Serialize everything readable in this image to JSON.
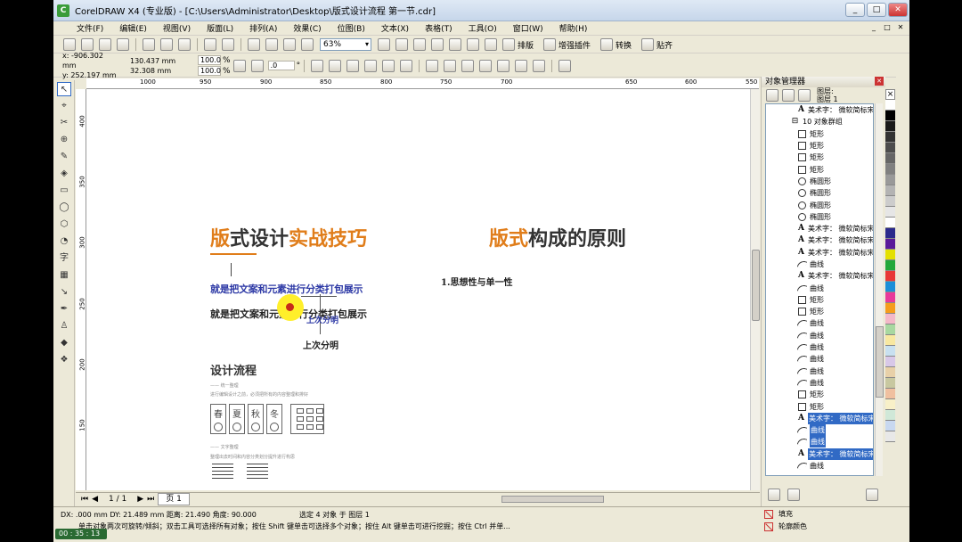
{
  "window": {
    "title": "CorelDRAW X4 (专业版) - [C:\\Users\\Administrator\\Desktop\\版式设计流程 第一节.cdr]",
    "app_icon_text": "C",
    "minimize": "_",
    "maximize": "□",
    "close": "✕"
  },
  "menu": [
    "文件(F)",
    "编辑(E)",
    "视图(V)",
    "版面(L)",
    "排列(A)",
    "效果(C)",
    "位图(B)",
    "文本(X)",
    "表格(T)",
    "工具(O)",
    "窗口(W)",
    "帮助(H)"
  ],
  "toolbar": {
    "zoom": "63%",
    "typeset": "排版",
    "plugin": "增强插件",
    "convert": "转换",
    "paste": "贴齐"
  },
  "property_bar": {
    "x": "x: -906.302 mm",
    "y": "y: 252.197 mm",
    "width": "130.437 mm",
    "height": "32.308 mm",
    "scale_x": "100.0",
    "scale_y": "100.0",
    "percent": "%",
    "rotation": ".0",
    "degree": "°"
  },
  "ruler": {
    "h_ticks": [
      "1000",
      "950",
      "900",
      "850",
      "800",
      "750",
      "700",
      "650",
      "600",
      "550"
    ],
    "v_ticks": [
      "400",
      "350",
      "300",
      "250",
      "200",
      "150"
    ]
  },
  "canvas": {
    "title_left_orange1": "版",
    "title_left_dark1": "式设计",
    "title_left_orange2": "实战技巧",
    "title_right_orange": "版式",
    "title_right_dark": "构成的原则",
    "blue_line": "就是把文案和元素进行分类打包展示",
    "black_line": "就是把文案和元素进行分类打包展示",
    "sub_blue": "上次分明",
    "sub_black": "上次分明",
    "point1": "1.思想性与单一性",
    "section_title": "设计流程",
    "tiny1": "—— 统一整理",
    "tiny2": "进行编辑设计之前，必须把所有的内容整理和排好",
    "seasons": [
      "春",
      "夏",
      "秋",
      "冬"
    ],
    "tiny3": "—— 文字整理",
    "tiny4": "整理出去时间和内容分类划分提升进行构思"
  },
  "page_nav": {
    "first": "⏮",
    "prev": "◀",
    "page_count": "1 / 1",
    "next": "▶",
    "last": "⏭",
    "page_tab": "页 1"
  },
  "docker": {
    "title": "对象管理器",
    "layer_label": "图层:",
    "layer_name": "图层 1",
    "items": [
      {
        "type": "A",
        "label": "美术字： 微软简标宋",
        "selected": false,
        "group": false
      },
      {
        "type": "grp",
        "label": "10 对象群组",
        "selected": false,
        "group": true
      },
      {
        "type": "rect",
        "label": "矩形",
        "selected": false,
        "group": false
      },
      {
        "type": "rect",
        "label": "矩形",
        "selected": false,
        "group": false
      },
      {
        "type": "rect",
        "label": "矩形",
        "selected": false,
        "group": false
      },
      {
        "type": "rect",
        "label": "矩形",
        "selected": false,
        "group": false
      },
      {
        "type": "ell",
        "label": "椭圆形",
        "selected": false,
        "group": false
      },
      {
        "type": "ell",
        "label": "椭圆形",
        "selected": false,
        "group": false
      },
      {
        "type": "ell",
        "label": "椭圆形",
        "selected": false,
        "group": false
      },
      {
        "type": "ell",
        "label": "椭圆形",
        "selected": false,
        "group": false
      },
      {
        "type": "A",
        "label": "美术字： 微软简标宋",
        "selected": false,
        "group": false
      },
      {
        "type": "A",
        "label": "美术字： 微软简标宋",
        "selected": false,
        "group": false
      },
      {
        "type": "A",
        "label": "美术字： 微软简标宋",
        "selected": false,
        "group": false
      },
      {
        "type": "curve",
        "label": "曲线",
        "selected": false,
        "group": false
      },
      {
        "type": "A",
        "label": "美术字： 微软简标宋",
        "selected": false,
        "group": false
      },
      {
        "type": "curve",
        "label": "曲线",
        "selected": false,
        "group": false
      },
      {
        "type": "rect",
        "label": "矩形",
        "selected": false,
        "group": false
      },
      {
        "type": "rect",
        "label": "矩形",
        "selected": false,
        "group": false
      },
      {
        "type": "curve",
        "label": "曲线",
        "selected": false,
        "group": false
      },
      {
        "type": "curve",
        "label": "曲线",
        "selected": false,
        "group": false
      },
      {
        "type": "curve",
        "label": "曲线",
        "selected": false,
        "group": false
      },
      {
        "type": "curve",
        "label": "曲线",
        "selected": false,
        "group": false
      },
      {
        "type": "curve",
        "label": "曲线",
        "selected": false,
        "group": false
      },
      {
        "type": "curve",
        "label": "曲线",
        "selected": false,
        "group": false
      },
      {
        "type": "rect",
        "label": "矩形",
        "selected": false,
        "group": false
      },
      {
        "type": "rect",
        "label": "矩形",
        "selected": false,
        "group": false
      },
      {
        "type": "A",
        "label": "美术字： 微软简标宋",
        "selected": true,
        "group": false
      },
      {
        "type": "curve",
        "label": "曲线",
        "selected": true,
        "group": false
      },
      {
        "type": "curve",
        "label": "曲线",
        "selected": true,
        "group": false
      },
      {
        "type": "A",
        "label": "美术字： 微软简标宋",
        "selected": true,
        "group": false
      },
      {
        "type": "curve",
        "label": "曲线",
        "selected": false,
        "group": false
      }
    ]
  },
  "palette": [
    "#ffffff",
    "#000000",
    "#1a1a1a",
    "#333333",
    "#4d4d4d",
    "#666666",
    "#808080",
    "#999999",
    "#b3b3b3",
    "#cccccc",
    "#e6e6e6",
    "#ffffff",
    "#2b2a8c",
    "#5a1a9a",
    "#e4e000",
    "#22a83a",
    "#e83838",
    "#1c8fd8",
    "#e83a9a",
    "#f59d1c",
    "#f4b8c8",
    "#a8d8a0",
    "#f8e8a0",
    "#c8e0f0",
    "#d8c8e8",
    "#e8d0a8",
    "#c8c8a0",
    "#f0c0a0",
    "#f8f0c8",
    "#d0e8d8",
    "#c8d8f0",
    "#e8e8e8"
  ],
  "status": {
    "dx": "DX: .000 mm DY: 21.489 mm 距离: 21.490 角度: 90.000",
    "selection": "选定 4 对象 于 图层 1",
    "hint": "单击对象两次可旋转/倾斜；双击工具可选择所有对象；按住 Shift 键单击可选择多个对象；按住 Alt 键单击可进行挖掘；按住 Ctrl 并单...",
    "fill_label": "填充",
    "outline_label": "轮廓颜色",
    "timer": "00 : 35 : 13"
  }
}
